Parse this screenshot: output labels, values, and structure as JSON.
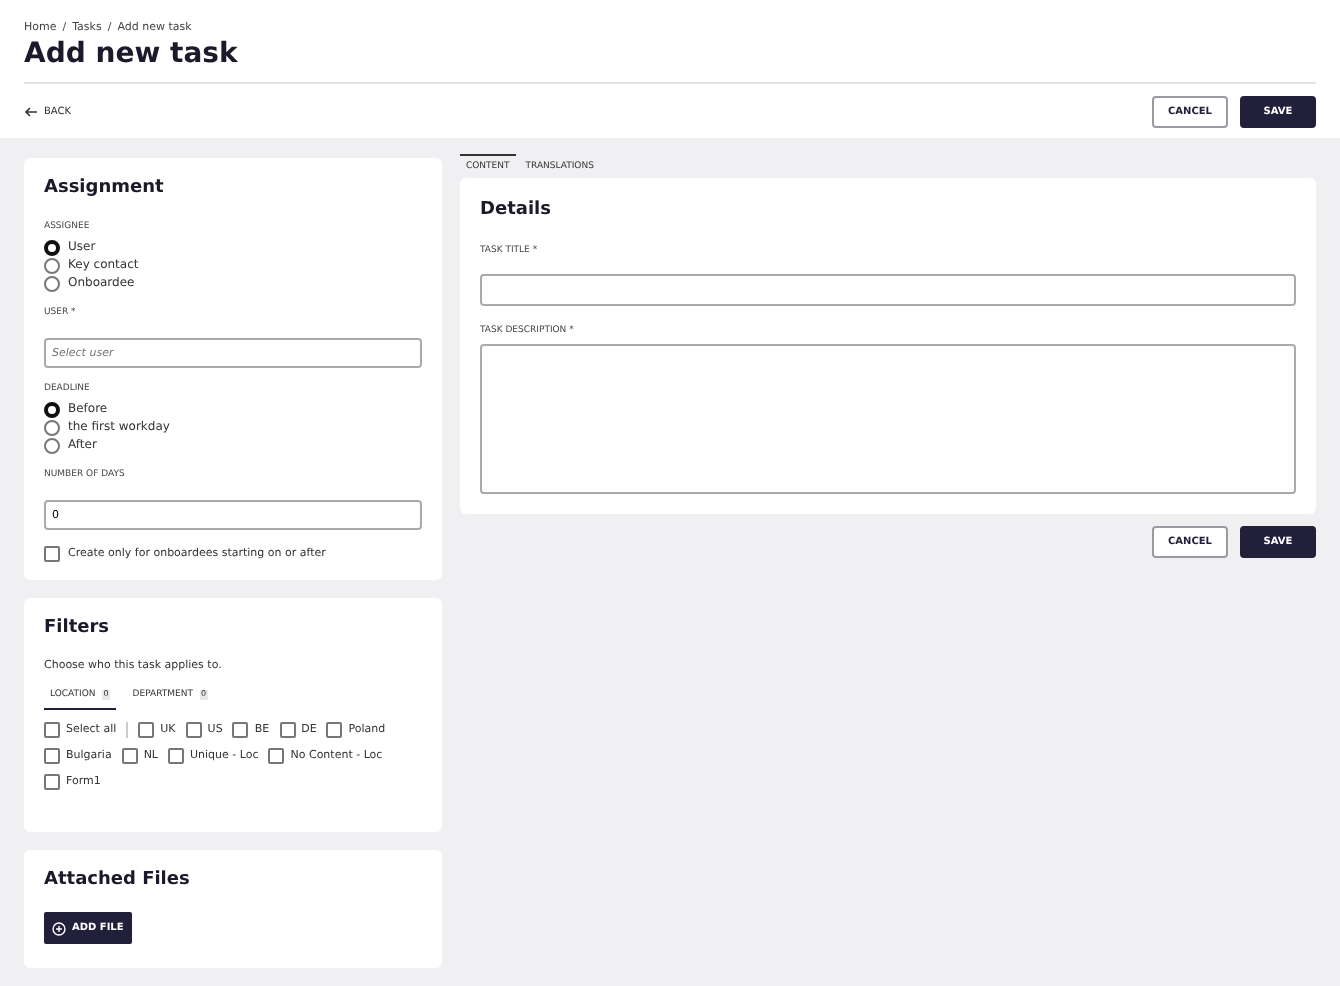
{
  "breadcrumbs": [
    "Home",
    "Tasks",
    "Add new task"
  ],
  "breadcrumb_separator": "/",
  "title": "Add new task",
  "back_label": "BACK",
  "header_buttons": [
    {
      "label": "CANCEL",
      "kind": "secondary"
    },
    {
      "label": "SAVE",
      "kind": "primary"
    }
  ],
  "assignment": {
    "title": "Assignment",
    "assignee_label": "ASSIGNEE",
    "assignee_options": [
      {
        "label": "User",
        "selected": true
      },
      {
        "label": "Key contact",
        "selected": false
      },
      {
        "label": "Onboardee",
        "selected": false
      }
    ],
    "user_label": "USER *",
    "user_placeholder": "Select user",
    "deadline_label": "DEADLINE",
    "deadline_options": [
      {
        "label": "Before",
        "selected": true
      },
      {
        "label": "the first workday",
        "selected": false
      },
      {
        "label": "After",
        "selected": false
      }
    ],
    "days_label": "NUMBER OF DAYS",
    "days_value": "0",
    "only_new": {
      "label": "Create only for onboardees starting on or after",
      "checked": false
    }
  },
  "filters": {
    "title": "Filters",
    "hint": "Choose who this task applies to.",
    "tabs": [
      {
        "label": "LOCATION",
        "count": "0",
        "selected": true
      },
      {
        "label": "DEPARTMENT",
        "count": "0",
        "selected": false
      }
    ],
    "options": [
      {
        "label": "Select all",
        "checked": false,
        "kind": "all"
      },
      {
        "label": "UK",
        "checked": false,
        "kind": "item"
      },
      {
        "label": "US",
        "checked": false,
        "kind": "item"
      },
      {
        "label": "BE",
        "checked": false,
        "kind": "item"
      },
      {
        "label": "DE",
        "checked": false,
        "kind": "item"
      },
      {
        "label": "Poland",
        "checked": false,
        "kind": "item"
      },
      {
        "label": "Bulgaria",
        "checked": false,
        "kind": "item"
      },
      {
        "label": "NL",
        "checked": false,
        "kind": "item"
      },
      {
        "label": "Unique - Loc",
        "checked": false,
        "kind": "item"
      },
      {
        "label": "No Content - Loc",
        "checked": false,
        "kind": "item"
      },
      {
        "label": "Form1",
        "checked": false,
        "kind": "item"
      }
    ]
  },
  "files": {
    "title": "Attached Files",
    "button": "ADD FILE"
  },
  "content_tabs": [
    {
      "label": "CONTENT",
      "selected": true
    },
    {
      "label": "TRANSLATIONS",
      "selected": false
    }
  ],
  "details": {
    "title": "Details",
    "task_title_label": "TASK TITLE *",
    "description_label": "TASK DESCRIPTION *"
  },
  "footer_buttons": [
    {
      "label": "CANCEL",
      "kind": "secondary"
    },
    {
      "label": "SAVE",
      "kind": "primary"
    }
  ]
}
